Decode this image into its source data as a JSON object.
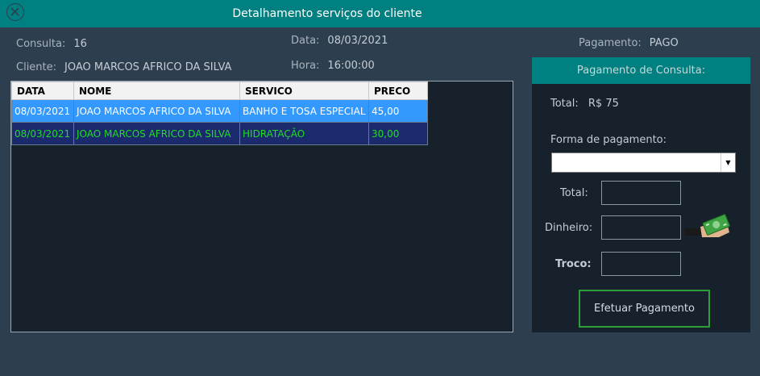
{
  "window": {
    "title": "Detalhamento serviços do cliente"
  },
  "info": {
    "consulta_label": "Consulta:",
    "consulta_value": "16",
    "cliente_label": "Cliente:",
    "cliente_value": "JOAO MARCOS AFRICO DA SILVA",
    "data_label": "Data:",
    "data_value": "08/03/2021",
    "hora_label": "Hora:",
    "hora_value": "16:00:00",
    "pagamento_label": "Pagamento:",
    "pagamento_value": "PAGO"
  },
  "grid": {
    "columns": [
      "DATA",
      "NOME",
      "SERVICO",
      "PRECO"
    ],
    "rows": [
      [
        "08/03/2021",
        "JOAO MARCOS AFRICO DA SILVA",
        "BANHO E TOSA ESPECIAL",
        "45,00"
      ],
      [
        "08/03/2021",
        "JOAO MARCOS AFRICO DA SILVA",
        "HIDRATAÇÃO",
        "30,00"
      ]
    ]
  },
  "payment": {
    "header": "Pagamento de Consulta:",
    "total_label": "Total:",
    "total_value": "R$ 75",
    "forma_label": "Forma de pagamento:",
    "forma_selected": "",
    "field_total_label": "Total:",
    "field_total_value": "",
    "dinheiro_label": "Dinheiro:",
    "dinheiro_value": "",
    "troco_label": "Troco:",
    "troco_value": "",
    "submit_label": "Efetuar Pagamento",
    "money_icon": "cash-in-hand-icon"
  },
  "colors": {
    "titlebar": "#008080",
    "background": "#2d3e4e",
    "panel": "#17212b",
    "selected_row": "#3399ff",
    "alt_row": "#1a2a6c",
    "alt_row_text": "#22dd22",
    "button_border": "#2e9e3a"
  }
}
